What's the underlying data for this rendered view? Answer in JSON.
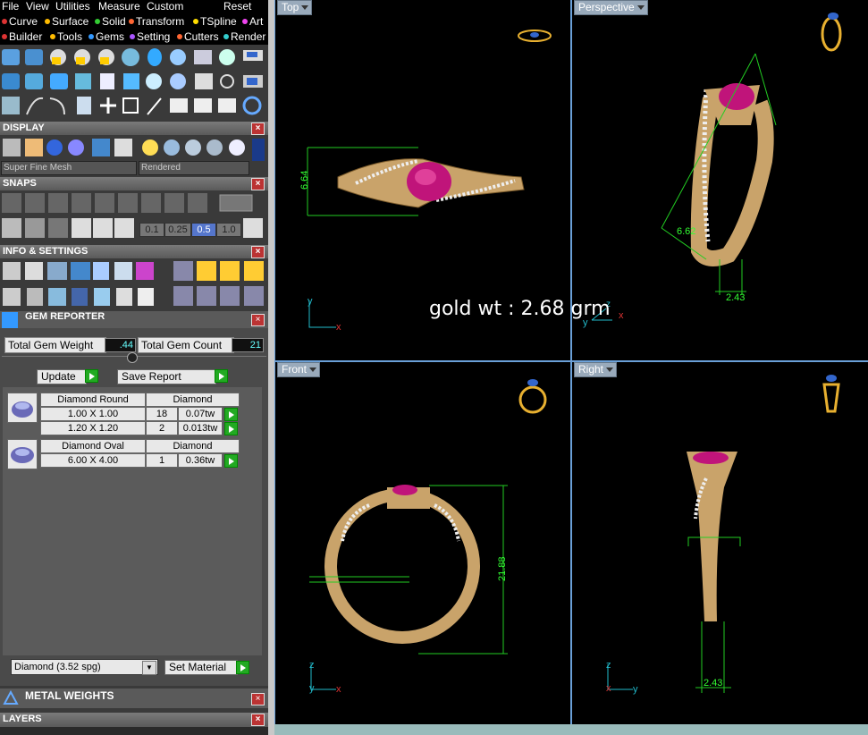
{
  "menu": [
    "File",
    "View",
    "Utilities",
    "Measure",
    "Custom",
    "Reset"
  ],
  "tabs_row1": [
    {
      "label": "Curve",
      "color": "#d33"
    },
    {
      "label": "Surface",
      "color": "#fb0"
    },
    {
      "label": "Solid",
      "color": "#3c3"
    },
    {
      "label": "Transform",
      "color": "#f63"
    },
    {
      "label": "TSpline",
      "color": "#fd0"
    },
    {
      "label": "Art",
      "color": "#e4e"
    }
  ],
  "tabs_row2": [
    {
      "label": "Builder",
      "color": "#d33"
    },
    {
      "label": "Tools",
      "color": "#fb0"
    },
    {
      "label": "Gems",
      "color": "#39f"
    },
    {
      "label": "Setting",
      "color": "#a5f"
    },
    {
      "label": "Cutters",
      "color": "#f63"
    },
    {
      "label": "Render",
      "color": "#3cc"
    }
  ],
  "display": {
    "title": "DISPLAY",
    "mesh_option": "Super Fine Mesh",
    "render_option": "Rendered"
  },
  "snaps": {
    "title": "SNAPS",
    "values": [
      "0.1",
      "0.25",
      "0.5",
      "1.0"
    ]
  },
  "info": {
    "title": "INFO & SETTINGS"
  },
  "gem_reporter": {
    "title": "GEM REPORTER",
    "total_weight_label": "Total Gem Weight",
    "total_weight_value": ".44",
    "total_count_label": "Total Gem Count",
    "total_count_value": "21",
    "update_label": "Update",
    "save_label": "Save Report",
    "groups": [
      {
        "shape": "Diamond Round",
        "material": "Diamond",
        "rows": [
          {
            "size": "1.00 X 1.00",
            "count": "18",
            "weight": "0.07tw"
          },
          {
            "size": "1.20 X 1.20",
            "count": "2",
            "weight": "0.013tw"
          }
        ]
      },
      {
        "shape": "Diamond Oval",
        "material": "Diamond",
        "rows": [
          {
            "size": "6.00 X 4.00",
            "count": "1",
            "weight": "0.36tw"
          }
        ]
      }
    ],
    "material_select": "Diamond     (3.52 spg)",
    "set_material_label": "Set Material"
  },
  "metal_weights": {
    "title": "METAL WEIGHTS"
  },
  "layers": {
    "title": "LAYERS"
  },
  "viewports": {
    "top": {
      "label": "Top",
      "dim": "6.64"
    },
    "perspective": {
      "label": "Perspective",
      "dims": [
        "6.62",
        "2.43"
      ]
    },
    "front": {
      "label": "Front",
      "dim": "21.88"
    },
    "right": {
      "label": "Right",
      "dim": "2.43"
    }
  },
  "overlay_text": "gold wt : 2.68 grm"
}
